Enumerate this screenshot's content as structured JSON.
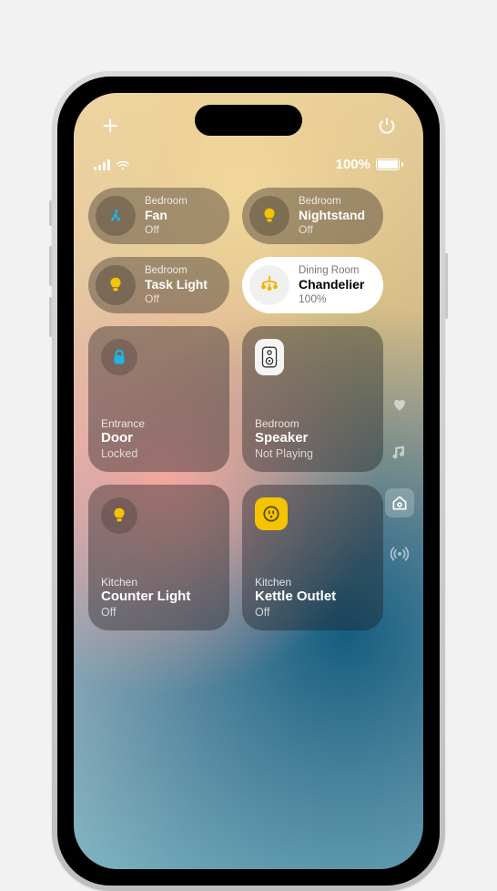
{
  "status": {
    "battery_text": "100%"
  },
  "homeTiles": {
    "pill_0": {
      "room": "Bedroom",
      "name": "Fan",
      "state": "Off"
    },
    "pill_1": {
      "room": "Bedroom",
      "name": "Nightstand",
      "state": "Off"
    },
    "pill_2": {
      "room": "Bedroom",
      "name": "Task Light",
      "state": "Off"
    },
    "pill_3": {
      "room": "Dining Room",
      "name": "Chandelier",
      "state": "100%"
    },
    "tile_0": {
      "room": "Entrance",
      "name": "Door",
      "state": "Locked"
    },
    "tile_1": {
      "room": "Bedroom",
      "name": "Speaker",
      "state": "Not Playing"
    },
    "tile_2": {
      "room": "Kitchen",
      "name": "Counter Light",
      "state": "Off"
    },
    "tile_3": {
      "room": "Kitchen",
      "name": "Kettle Outlet",
      "state": "Off"
    }
  },
  "colors": {
    "fan_icon": "#19b6f0",
    "bulb_icon": "#f4c400",
    "lock_icon": "#1eb5e6",
    "chandelier_icon": "#f4b400",
    "outlet_icon": "#f4c400"
  }
}
